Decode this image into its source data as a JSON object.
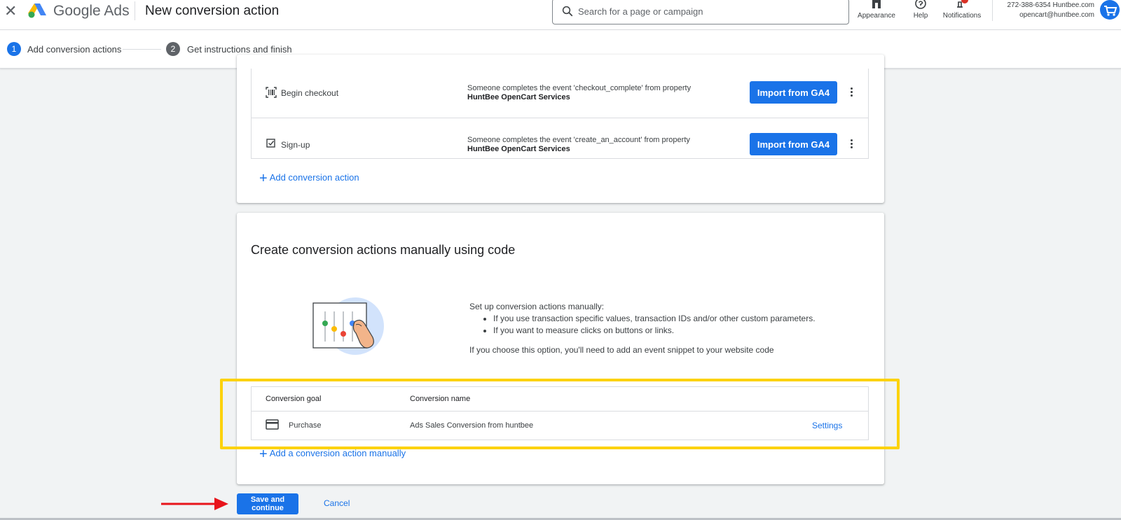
{
  "header": {
    "brand": "Google Ads",
    "page_title": "New conversion action",
    "search_placeholder": "Search for a page or campaign",
    "buttons": [
      {
        "label": "Appearance",
        "icon": "appearance-icon"
      },
      {
        "label": "Help",
        "icon": "help-icon"
      },
      {
        "label": "Notifications",
        "icon": "bell-icon"
      }
    ],
    "account": {
      "line1": "272-388-6354 Huntbee.com",
      "line2": "opencart@huntbee.com"
    }
  },
  "stepper": {
    "steps": [
      {
        "number": "1",
        "label": "Add conversion actions"
      },
      {
        "number": "2",
        "label": "Get instructions and finish"
      }
    ]
  },
  "import_card": {
    "events": [
      {
        "name": "Begin checkout",
        "icon": "barcode-scan-icon",
        "desc_line1": "Someone completes the event 'checkout_complete' from property",
        "desc_line2": "HuntBee OpenCart Services",
        "button": "Import from GA4"
      },
      {
        "name": "Sign-up",
        "icon": "checkbox-icon",
        "desc_line1": "Someone completes the event 'create_an_account' from property",
        "desc_line2": "HuntBee OpenCart Services",
        "button": "Import from GA4"
      }
    ],
    "add_link": "Add conversion action"
  },
  "manual_card": {
    "title": "Create conversion actions manually using code",
    "intro": "Set up conversion actions manually:",
    "bullets": [
      "If you use transaction specific values, transaction IDs and/or other custom parameters.",
      "If you want to measure clicks on buttons or links."
    ],
    "note": "If you choose this option, you'll need to add an event snippet to your website code",
    "table": {
      "headers": [
        "Conversion goal",
        "Conversion name"
      ],
      "row": {
        "goal": "Purchase",
        "goal_icon": "credit-card-icon",
        "name": "Ads Sales Conversion from huntbee",
        "action": "Settings"
      }
    },
    "add_link": "Add a conversion action manually"
  },
  "footer": {
    "save": "Save and continue",
    "cancel": "Cancel"
  },
  "colors": {
    "primary": "#1a73e8",
    "highlight": "#fcd20a",
    "arrow": "#e8141b"
  }
}
